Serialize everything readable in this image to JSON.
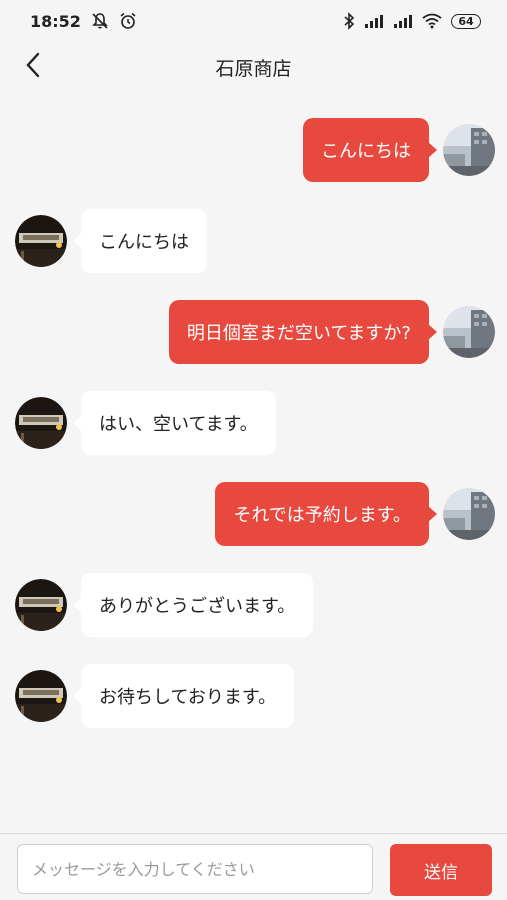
{
  "status_bar": {
    "time": "18:52",
    "battery": "64",
    "icons": [
      "mute-icon",
      "alarm-icon",
      "bluetooth-icon",
      "signal-icon",
      "signal-icon",
      "wifi-icon",
      "battery-icon"
    ]
  },
  "header": {
    "title": "石原商店",
    "back_icon": "chevron-left-icon"
  },
  "colors": {
    "accent": "#e8493f",
    "background": "#f5f5f5",
    "bubble_other": "#ffffff"
  },
  "messages": [
    {
      "sender": "me",
      "text": "こんにちは"
    },
    {
      "sender": "other",
      "text": "こんにちは"
    },
    {
      "sender": "me",
      "text": "明日個室まだ空いてますか?"
    },
    {
      "sender": "other",
      "text": "はい、空いてます。"
    },
    {
      "sender": "me",
      "text": "それでは予約します。"
    },
    {
      "sender": "other",
      "text": "ありがとうございます。"
    },
    {
      "sender": "other",
      "text": "お待ちしております。"
    }
  ],
  "composer": {
    "placeholder": "メッセージを入力してください",
    "value": "",
    "send_label": "送信"
  }
}
